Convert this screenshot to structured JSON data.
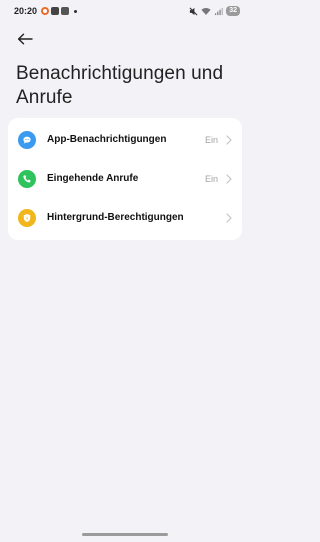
{
  "status_bar": {
    "time": "20:20",
    "battery": "32"
  },
  "header": {
    "back_icon": "arrow-left-icon",
    "title": "Benachrichtigungen und Anrufe"
  },
  "settings": {
    "items": [
      {
        "label": "App-Benachrichtigungen",
        "value": "Ein",
        "icon": "chat-bubble-icon",
        "color": "#3a9af0"
      },
      {
        "label": "Eingehende Anrufe",
        "value": "Ein",
        "icon": "phone-icon",
        "color": "#2fc35d"
      },
      {
        "label": "Hintergrund-Berechtigungen",
        "value": "",
        "icon": "shield-icon",
        "color": "#f0b61a"
      }
    ]
  }
}
